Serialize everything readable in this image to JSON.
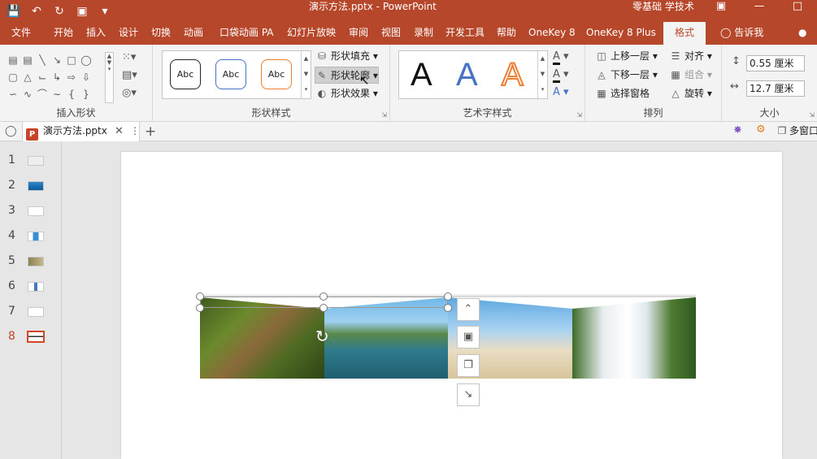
{
  "titlebar": {
    "title": "演示方法.pptx  -  PowerPoint",
    "user": "零基础 学技术",
    "qat_icons": [
      "save-icon",
      "undo-icon",
      "redo-icon",
      "slideshow-icon",
      "customize-icon"
    ]
  },
  "tabs": [
    {
      "label": "文件"
    },
    {
      "label": "开始"
    },
    {
      "label": "插入"
    },
    {
      "label": "设计"
    },
    {
      "label": "切换"
    },
    {
      "label": "动画"
    },
    {
      "label": "口袋动画 PA"
    },
    {
      "label": "幻灯片放映"
    },
    {
      "label": "审阅"
    },
    {
      "label": "视图"
    },
    {
      "label": "录制"
    },
    {
      "label": "开发工具"
    },
    {
      "label": "帮助"
    },
    {
      "label": "OneKey 8"
    },
    {
      "label": "OneKey 8 Plus"
    },
    {
      "label": "格式"
    }
  ],
  "tell_me": "告诉我",
  "ribbon": {
    "insert_shapes": {
      "label": "插入形状"
    },
    "shape_styles": {
      "label": "形状样式",
      "presets": [
        "Abc",
        "Abc",
        "Abc"
      ],
      "fill": "形状填充",
      "outline": "形状轮廓",
      "effects": "形状效果"
    },
    "wordart": {
      "label": "艺术字样式",
      "letters": [
        "A",
        "A",
        "A"
      ]
    },
    "arrange": {
      "label": "排列",
      "bring_forward": "上移一层",
      "send_backward": "下移一层",
      "selection_pane": "选择窗格",
      "align": "对齐",
      "group": "组合",
      "rotate": "旋转"
    },
    "size": {
      "label": "大小",
      "height": "0.55 厘米",
      "width": "12.7 厘米"
    }
  },
  "doctab": {
    "filename": "演示方法.pptx",
    "multiwindow": "多窗口"
  },
  "slides": [
    {
      "num": "1"
    },
    {
      "num": "2"
    },
    {
      "num": "3"
    },
    {
      "num": "4"
    },
    {
      "num": "5"
    },
    {
      "num": "6"
    },
    {
      "num": "7"
    },
    {
      "num": "8"
    }
  ],
  "colors": {
    "accent": "#b7472a",
    "selected": "#d24726"
  }
}
